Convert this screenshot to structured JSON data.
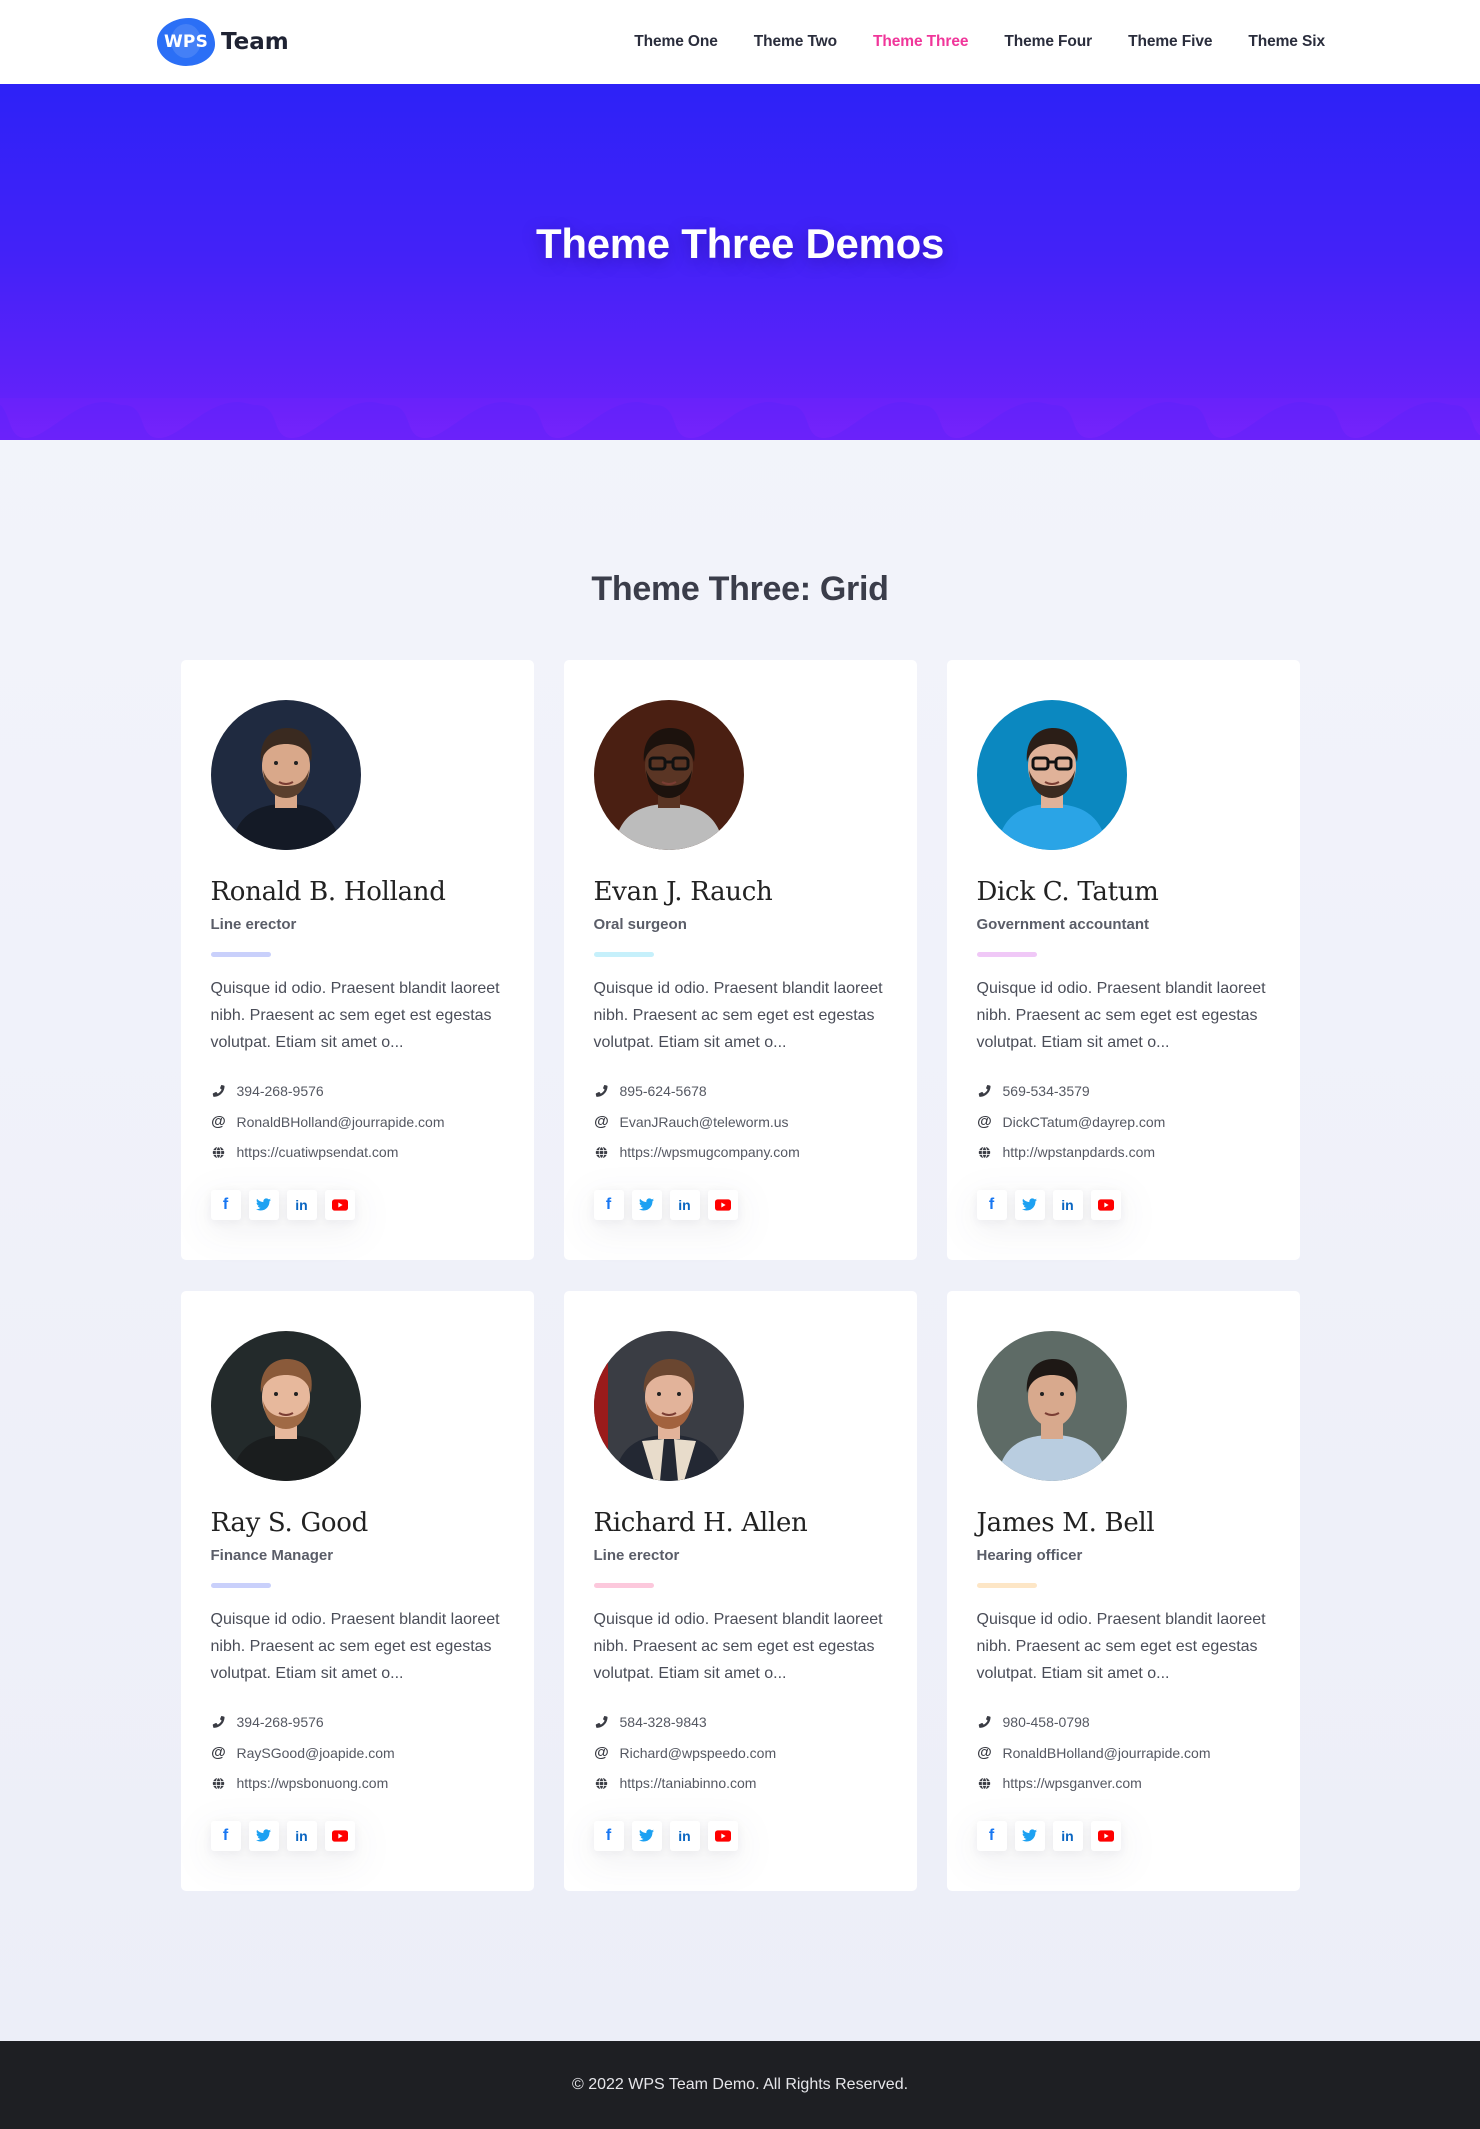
{
  "header": {
    "logo_badge": "WPS",
    "logo_text": "Team",
    "nav": [
      {
        "label": "Theme One",
        "active": false
      },
      {
        "label": "Theme Two",
        "active": false
      },
      {
        "label": "Theme Three",
        "active": true
      },
      {
        "label": "Theme Four",
        "active": false
      },
      {
        "label": "Theme Five",
        "active": false
      },
      {
        "label": "Theme Six",
        "active": false
      }
    ],
    "active_color": "#f0369a"
  },
  "hero": {
    "title": "Theme Three Demos",
    "gradient_top": "#2d22f7",
    "gradient_bottom": "#6b22fa"
  },
  "section": {
    "title": "Theme Three: Grid"
  },
  "members": [
    {
      "name": "Ronald B. Holland",
      "role": "Line erector",
      "accent": "#c9d0fb",
      "avatar": "man-dark-hoodie-beard",
      "bio": "Quisque id odio. Praesent blandit laoreet nibh. Praesent ac sem eget est egestas volutpat. Etiam sit amet o...",
      "phone": "394-268-9576",
      "email": "RonaldBHolland@jourrapide.com",
      "website": "https://cuatiwpsendat.com"
    },
    {
      "name": "Evan J. Rauch",
      "role": "Oral surgeon",
      "accent": "#c6f0fb",
      "avatar": "man-glasses-grey-sweater",
      "bio": "Quisque id odio. Praesent blandit laoreet nibh. Praesent ac sem eget est egestas volutpat. Etiam sit amet o...",
      "phone": "895-624-5678",
      "email": "EvanJRauch@teleworm.us",
      "website": "https://wpsmugcompany.com"
    },
    {
      "name": "Dick C. Tatum",
      "role": "Government accountant",
      "accent": "#f0c8f7",
      "avatar": "man-glasses-blue-shirt",
      "bio": "Quisque id odio. Praesent blandit laoreet nibh. Praesent ac sem eget est egestas volutpat. Etiam sit amet o...",
      "phone": "569-534-3579",
      "email": "DickCTatum@dayrep.com",
      "website": "http://wpstanpdards.com"
    },
    {
      "name": "Ray S. Good",
      "role": "Finance Manager",
      "accent": "#c9d0fb",
      "avatar": "man-smiling-dark-background",
      "bio": "Quisque id odio. Praesent blandit laoreet nibh. Praesent ac sem eget est egestas volutpat. Etiam sit amet o...",
      "phone": "394-268-9576",
      "email": "RaySGood@joapide.com",
      "website": "https://wpsbonuong.com"
    },
    {
      "name": "Richard H. Allen",
      "role": "Line erector",
      "accent": "#fcc8dc",
      "avatar": "man-shearling-jacket",
      "bio": "Quisque id odio. Praesent blandit laoreet nibh. Praesent ac sem eget est egestas volutpat. Etiam sit amet o...",
      "phone": "584-328-9843",
      "email": "Richard@wpspeedo.com",
      "website": "https://taniabinno.com"
    },
    {
      "name": "James M. Bell",
      "role": "Hearing officer",
      "accent": "#fde6c6",
      "avatar": "man-smiling-light-shirt",
      "bio": "Quisque id odio. Praesent blandit laoreet nibh. Praesent ac sem eget est egestas volutpat. Etiam sit amet o...",
      "phone": "980-458-0798",
      "email": "RonaldBHolland@jourrapide.com",
      "website": "https://wpsganver.com"
    }
  ],
  "social_icons": [
    "facebook-icon",
    "twitter-icon",
    "linkedin-icon",
    "youtube-icon"
  ],
  "contact_icons": {
    "phone": "phone-icon",
    "email": "at-sign-icon",
    "website": "globe-icon"
  },
  "footer": {
    "text": "© 2022 WPS Team Demo. All Rights Reserved."
  }
}
